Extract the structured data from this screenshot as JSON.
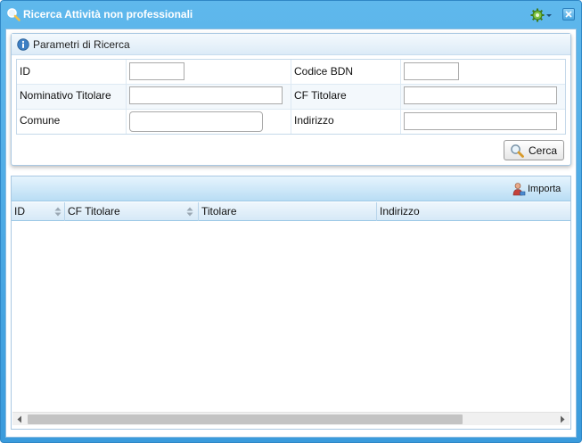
{
  "window": {
    "title": "Ricerca Attività non professionali",
    "icons": {
      "title": "search-icon",
      "menu": "gear-icon",
      "close": "close-icon"
    }
  },
  "search_panel": {
    "title": "Parametri di Ricerca",
    "fields": {
      "id": {
        "label": "ID",
        "value": ""
      },
      "codice_bdn": {
        "label": "Codice BDN",
        "value": ""
      },
      "nominativo_titolare": {
        "label": "Nominativo Titolare",
        "value": ""
      },
      "cf_titolare": {
        "label": "CF Titolare",
        "value": ""
      },
      "comune": {
        "label": "Comune",
        "value": ""
      },
      "indirizzo": {
        "label": "Indirizzo",
        "value": ""
      }
    },
    "search_button": "Cerca"
  },
  "results_grid": {
    "toolbar": {
      "import_button": "Importa"
    },
    "columns": [
      "ID",
      "CF Titolare",
      "Titolare",
      "Indirizzo"
    ],
    "rows": []
  },
  "colors": {
    "title_bar": "#3a9bdc",
    "panel_header": "#dcebf7",
    "grid_toolbar": "#b9ddf4"
  }
}
